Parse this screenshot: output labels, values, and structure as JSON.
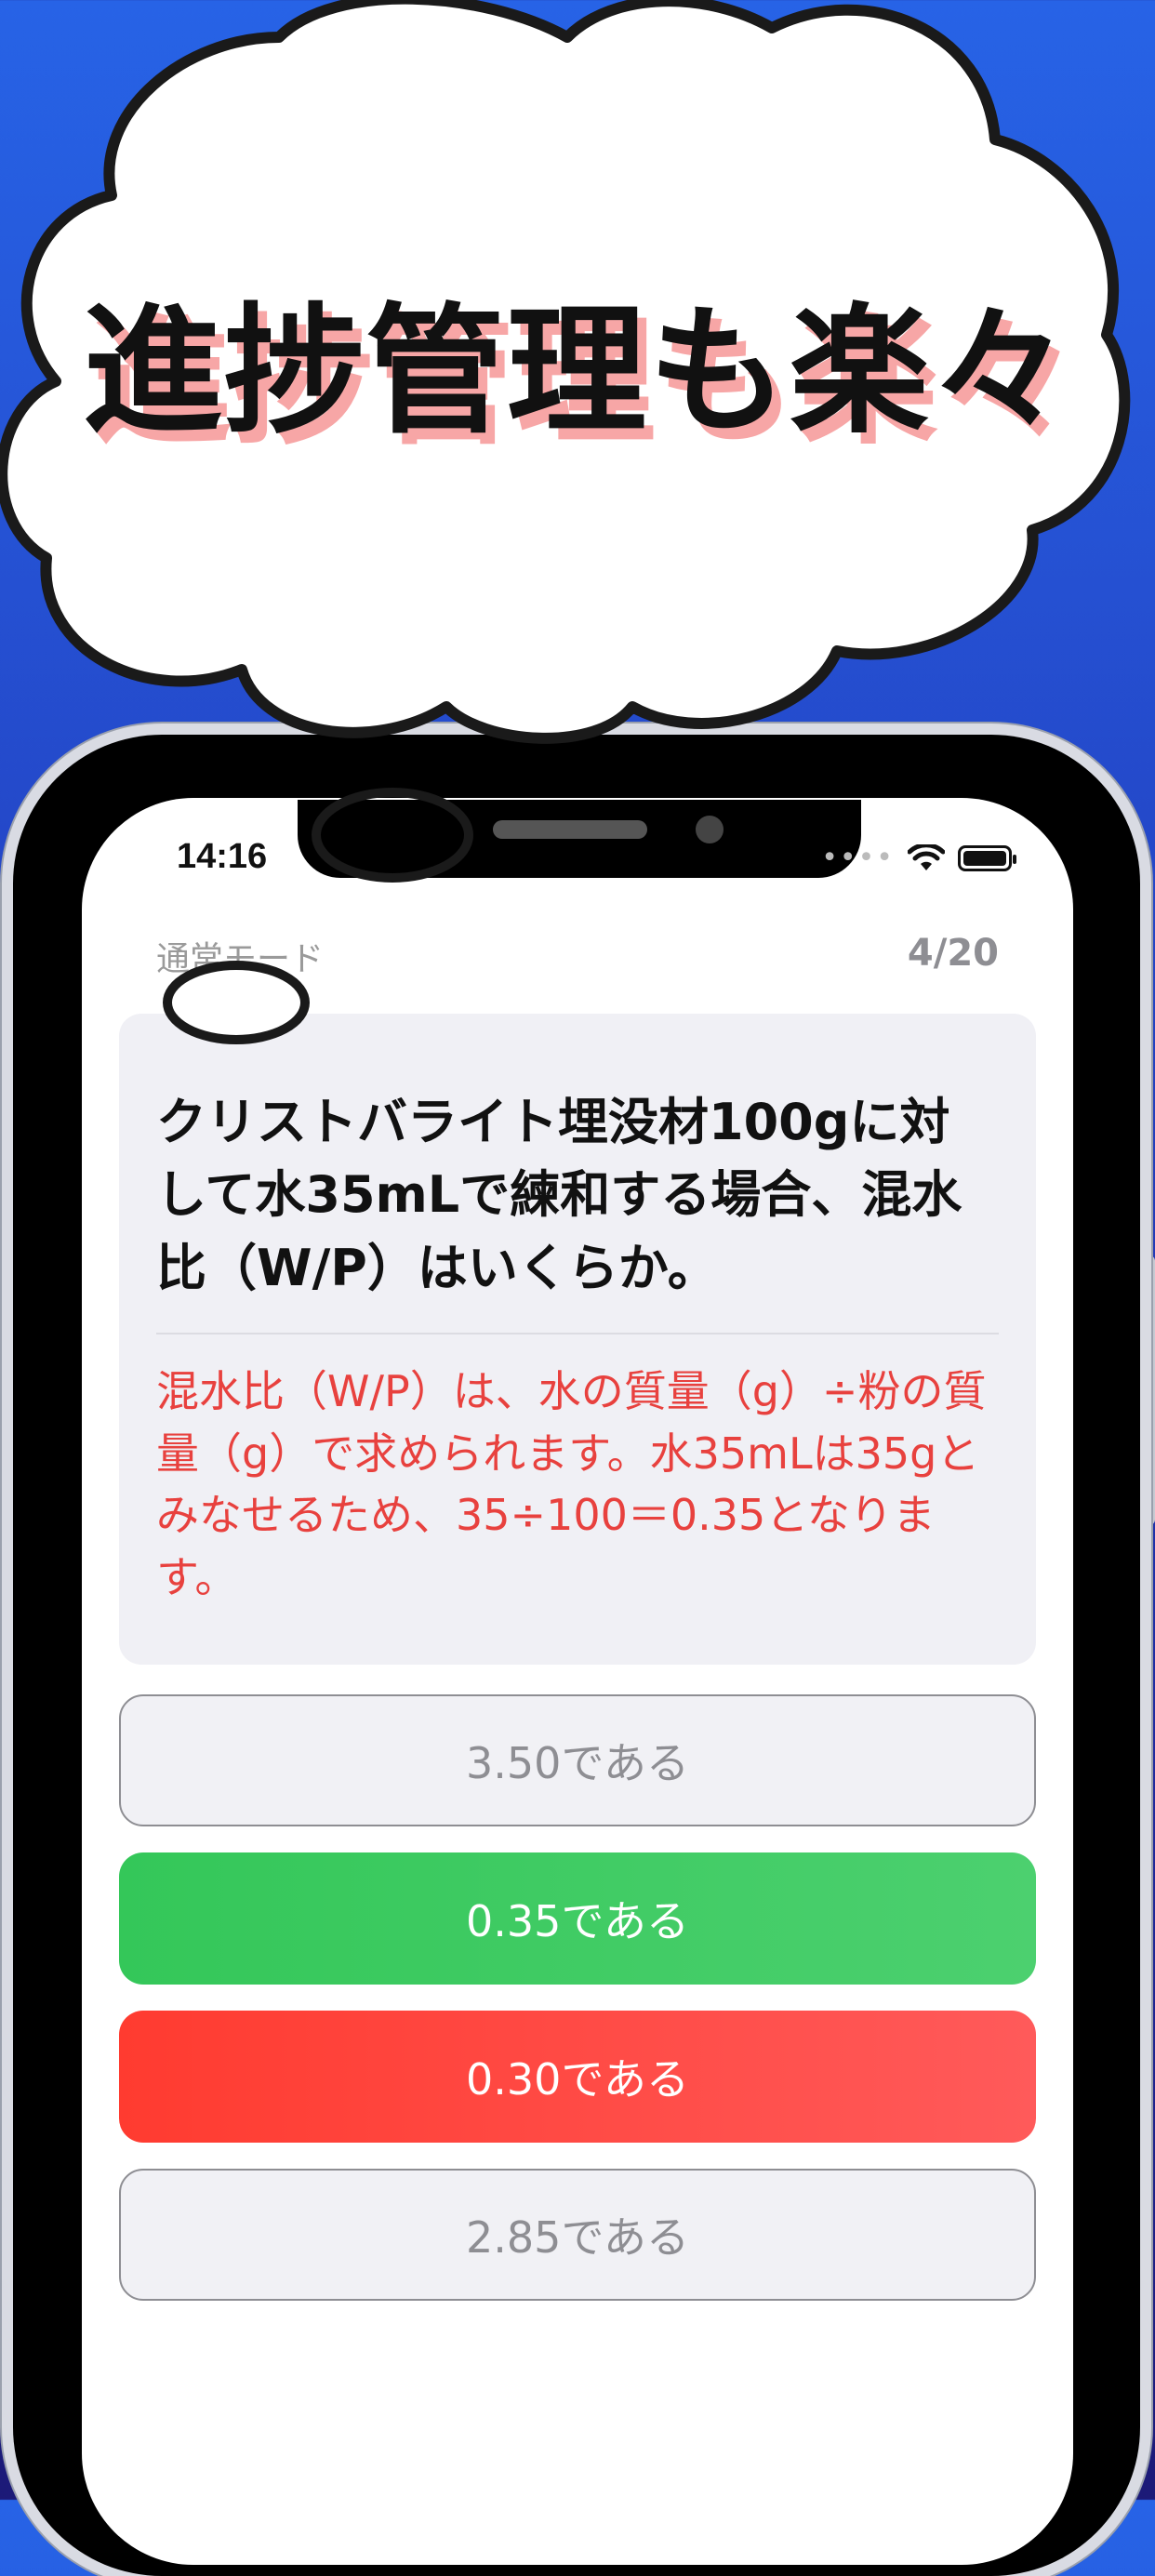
{
  "banner": {
    "headline": "進捗管理も楽々"
  },
  "status_bar": {
    "time": "14:16"
  },
  "quiz": {
    "mode": "通常モード",
    "progress": "4/20",
    "question": "クリストバライト埋没材100gに対して水35mLで練和する場合、混水比（W/P）はいくらか。",
    "explanation": "混水比（W/P）は、水の質量（g）÷粉の質量（g）で求められます。水35mLは35gとみなせるため、35÷100＝0.35となります。",
    "answers": [
      {
        "label": "3.50である",
        "state": "neutral"
      },
      {
        "label": "0.35である",
        "state": "correct"
      },
      {
        "label": "0.30である",
        "state": "wrong"
      },
      {
        "label": "2.85である",
        "state": "neutral"
      }
    ]
  },
  "colors": {
    "correct": "#34c759",
    "wrong": "#ff3b30",
    "explanation": "#e8413e",
    "background_top": "#2763e6",
    "background_bottom": "#1c1a78"
  }
}
